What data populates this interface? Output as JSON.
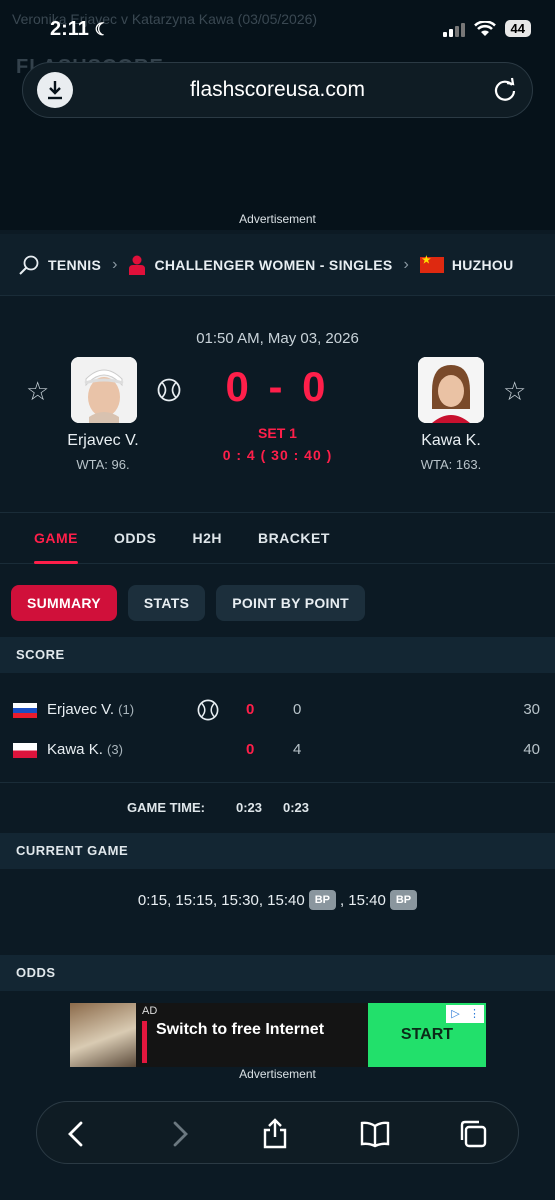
{
  "ghost": {
    "page_title": "Veronika Erjavec v Katarzyna Kawa (03/05/2026)",
    "logo_text": "FLASHSCORE"
  },
  "status_bar": {
    "time": "2:11",
    "battery": "44"
  },
  "browser": {
    "url": "flashscoreusa.com"
  },
  "ads": {
    "top_label": "Advertisement",
    "bottom_label": "Advertisement"
  },
  "breadcrumb": {
    "sport": "TENNIS",
    "category": "CHALLENGER WOMEN - SINGLES",
    "tournament": "HUZHOU"
  },
  "match": {
    "datetime": "01:50 AM, May 03, 2026",
    "score": "0 - 0",
    "set_label": "SET 1",
    "set_score": "0 : 4 ( 30 : 40 )",
    "home": {
      "name": "Erjavec V.",
      "rank": "WTA: 96."
    },
    "away": {
      "name": "Kawa K.",
      "rank": "WTA: 163."
    }
  },
  "tabs": [
    "GAME",
    "ODDS",
    "H2H",
    "BRACKET"
  ],
  "subtabs": [
    "SUMMARY",
    "STATS",
    "POINT BY POINT"
  ],
  "sections": {
    "score": "SCORE",
    "current_game": "CURRENT GAME",
    "odds": "ODDS"
  },
  "score_table": [
    {
      "name": "Erjavec V.",
      "seed": "(1)",
      "sets": "0",
      "games": "0",
      "points": "30",
      "serving": true
    },
    {
      "name": "Kawa K.",
      "seed": "(3)",
      "sets": "0",
      "games": "4",
      "points": "40",
      "serving": false
    }
  ],
  "game_time": {
    "label": "GAME TIME:",
    "total": "0:23",
    "set1": "0:23"
  },
  "current_game": {
    "sequence": "0:15, 15:15, 15:30, 15:40",
    "bp1": "BP",
    "mid": ", 15:40",
    "bp2": "BP"
  },
  "banner": {
    "ad_tag": "AD",
    "text": "Switch to free Internet",
    "cta": "START"
  },
  "colors": {
    "accent": "#ff1f4a",
    "background": "#0c1a24",
    "cta_green": "#22e06b"
  }
}
